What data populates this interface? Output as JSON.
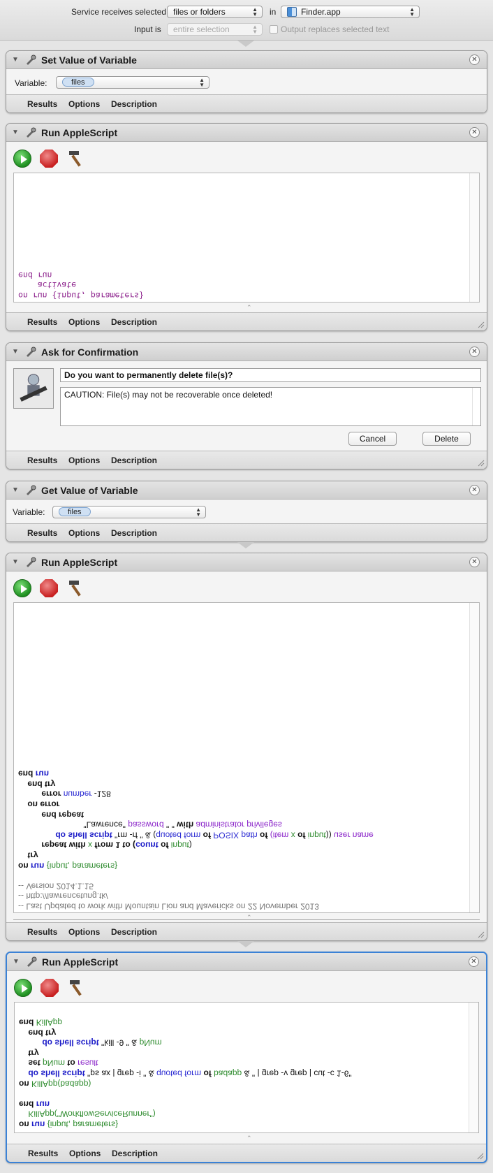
{
  "header": {
    "service_receives_label": "Service receives selected",
    "service_receives_value": "files or folders",
    "in_label": "in",
    "app_value": "Finder.app",
    "input_is_label": "Input is",
    "input_is_value": "entire selection",
    "output_replaces_label": "Output replaces selected text"
  },
  "tabs": {
    "results": "Results",
    "options": "Options",
    "description": "Description"
  },
  "set_variable": {
    "title": "Set Value of Variable",
    "variable_label": "Variable:",
    "variable_value": "files"
  },
  "script1": {
    "title": "Run AppleScript",
    "lines": [
      "on run {input, parameters}",
      "    activate",
      "end run"
    ]
  },
  "confirm": {
    "title": "Ask for Confirmation",
    "question": "Do you want to permanently delete file(s)?",
    "message": "CAUTION: File(s) may not be recoverable once deleted!",
    "cancel": "Cancel",
    "delete": "Delete"
  },
  "get_variable": {
    "title": "Get Value of Variable",
    "variable_label": "Variable:",
    "variable_value": "files"
  },
  "script2": {
    "title": "Run AppleScript",
    "comment1": "-- Last Updated to work with Mountain Lion and Mavericks on 22 November 2013",
    "comment2": "-- http://lawrencetung.tk/",
    "comment3": "-- Version 2014.1.15",
    "l_on": "on",
    "l_run": "run",
    "l_params": "{input, parameters}",
    "l_try": "try",
    "l_repeat": "repeat with",
    "l_x": "x",
    "l_from": "from 1 to (",
    "l_count": "count",
    "l_of": "of",
    "l_input": "input",
    "l_close": ")",
    "l_do": "do shell script",
    "l_rm": "\"rm -rf \" & (",
    "l_quoted": "quoted form",
    "l_of2": "of",
    "l_posix": "POSIX",
    "l_path": "path",
    "l_of3": "of",
    "l_item": "(item",
    "l_x2": "x",
    "l_of4": "of",
    "l_input2": "input",
    "l_close2": "))",
    "l_user": "user name",
    "l_user_val": "\"Lawrence\"",
    "l_password": "password",
    "l_pw_val": "\" \"",
    "l_with": "with",
    "l_admin": "administrator privileges",
    "l_endrepeat": "end repeat",
    "l_onerror": "on error",
    "l_error": "error",
    "l_number": "number",
    "l_num": "-128",
    "l_endtry": "end try",
    "l_end": "end",
    "l_run2": "run"
  },
  "script3": {
    "title": "Run AppleScript",
    "l1_on": "on",
    "l1_run": "run",
    "l1_params": "{input, parameters}",
    "l2_call": "KillApp(\"WorkflowServiceRunner\")",
    "l3_end": "end",
    "l3_run": "run",
    "l5_on": "on",
    "l5_name": "KillApp(badapp)",
    "l6_do": "do shell script",
    "l6_a": "\"ps ax | grep -i \" & ",
    "l6_qf": "quoted form",
    "l6_of": "of",
    "l6_badapp": "badapp",
    "l6_b": " & \" | grep -v grep | cut -c 1-6\"",
    "l7_set": "set",
    "l7_pnum": "pNum",
    "l7_to": "to",
    "l7_result": "result",
    "l8_try": "try",
    "l9_do": "do shell script",
    "l9_a": "\"kill -9 \" & ",
    "l9_pnum": "pNum",
    "l10_endtry": "end try",
    "l11_end": "end",
    "l11_name": "KillApp"
  },
  "colors": {
    "selection_border": "#3b82d6",
    "keyword_blue": "#1c1cc8",
    "variable_green": "#2e8b2e",
    "class_purple": "#8a24c9"
  }
}
